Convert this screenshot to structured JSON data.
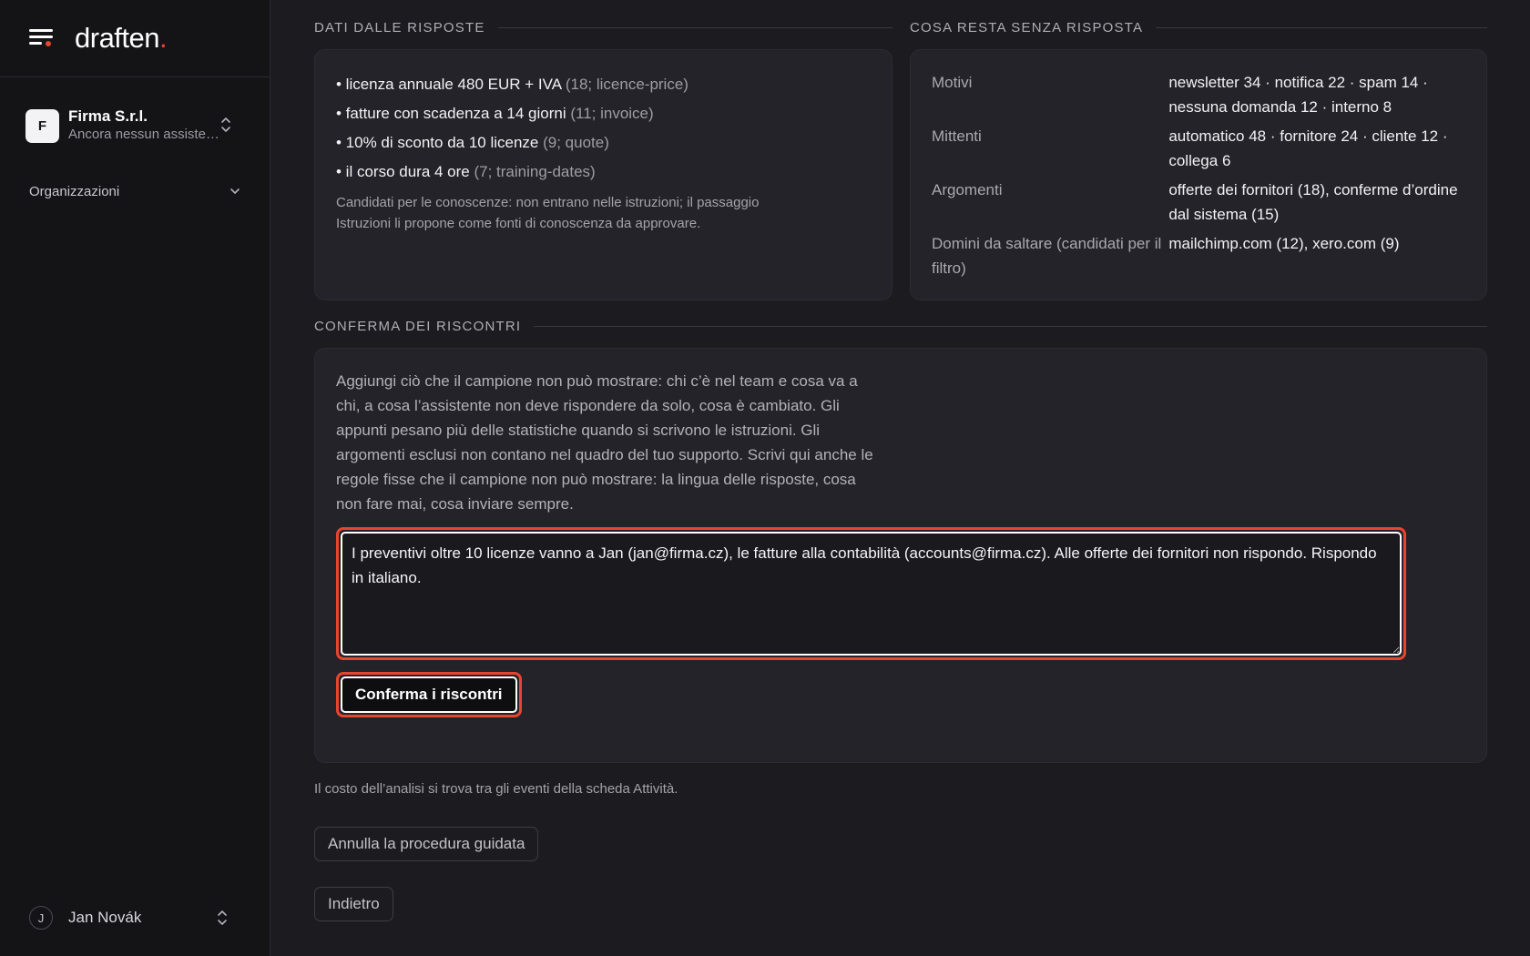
{
  "brand": {
    "logo_text": "draften",
    "logo_dot": ".",
    "accent_color": "#e8452e"
  },
  "sidebar": {
    "org": {
      "avatar_letter": "F",
      "name": "Firma S.r.l.",
      "subtitle": "Ancora nessun assistente"
    },
    "organizations_label": "Organizzazioni",
    "user": {
      "avatar_letter": "J",
      "name": "Jan Novák"
    }
  },
  "facts_section": {
    "title": "DATI DALLE RISPOSTE",
    "items": [
      {
        "text": "• licenza annuale 480 EUR + IVA",
        "meta": "(18; licence-price)"
      },
      {
        "text": "• fatture con scadenza a 14 giorni",
        "meta": "(11; invoice)"
      },
      {
        "text": "• 10% di sconto da 10 licenze",
        "meta": "(9; quote)"
      },
      {
        "text": "• il corso dura 4 ore",
        "meta": "(7; training-dates)"
      }
    ],
    "note": "Candidati per le conoscenze: non entrano nelle istruzioni; il passaggio Istruzioni li propone come fonti di conoscenza da approvare."
  },
  "unanswered_section": {
    "title": "COSA RESTA SENZA RISPOSTA",
    "rows": [
      {
        "label": "Motivi",
        "value": "newsletter 34 · notifica 22 · spam 14 · nessuna domanda 12 · interno 8"
      },
      {
        "label": "Mittenti",
        "value": "automatico 48 · fornitore 24 · cliente 12 · collega 6"
      },
      {
        "label": "Argomenti",
        "value": "offerte dei fornitori (18), conferme d’ordine dal sistema (15)"
      },
      {
        "label": "Domini da saltare (candidati per il filtro)",
        "value": "mailchimp.com (12), xero.com (9)"
      }
    ]
  },
  "confirm_section": {
    "title": "CONFERMA DEI RISCONTRI",
    "description": "Aggiungi ciò che il campione non può mostrare: chi c’è nel team e cosa va a chi, a cosa l’assistente non deve rispondere da solo, cosa è cambiato. Gli appunti pesano più delle statistiche quando si scrivono le istruzioni. Gli argomenti esclusi non contano nel quadro del tuo supporto. Scrivi qui anche le regole fisse che il campione non può mostrare: la lingua delle risposte, cosa non fare mai, cosa inviare sempre.",
    "textarea_value": "I preventivi oltre 10 licenze vanno a Jan (jan@firma.cz), le fatture alla contabilità (accounts@firma.cz). Alle offerte dei fornitori non rispondo. Rispondo in italiano.",
    "button_label": "Conferma i riscontri"
  },
  "footer": {
    "cost_note": "Il costo dell’analisi si trova tra gli eventi della scheda Attività.",
    "cancel_label": "Annulla la procedura guidata",
    "back_label": "Indietro"
  }
}
